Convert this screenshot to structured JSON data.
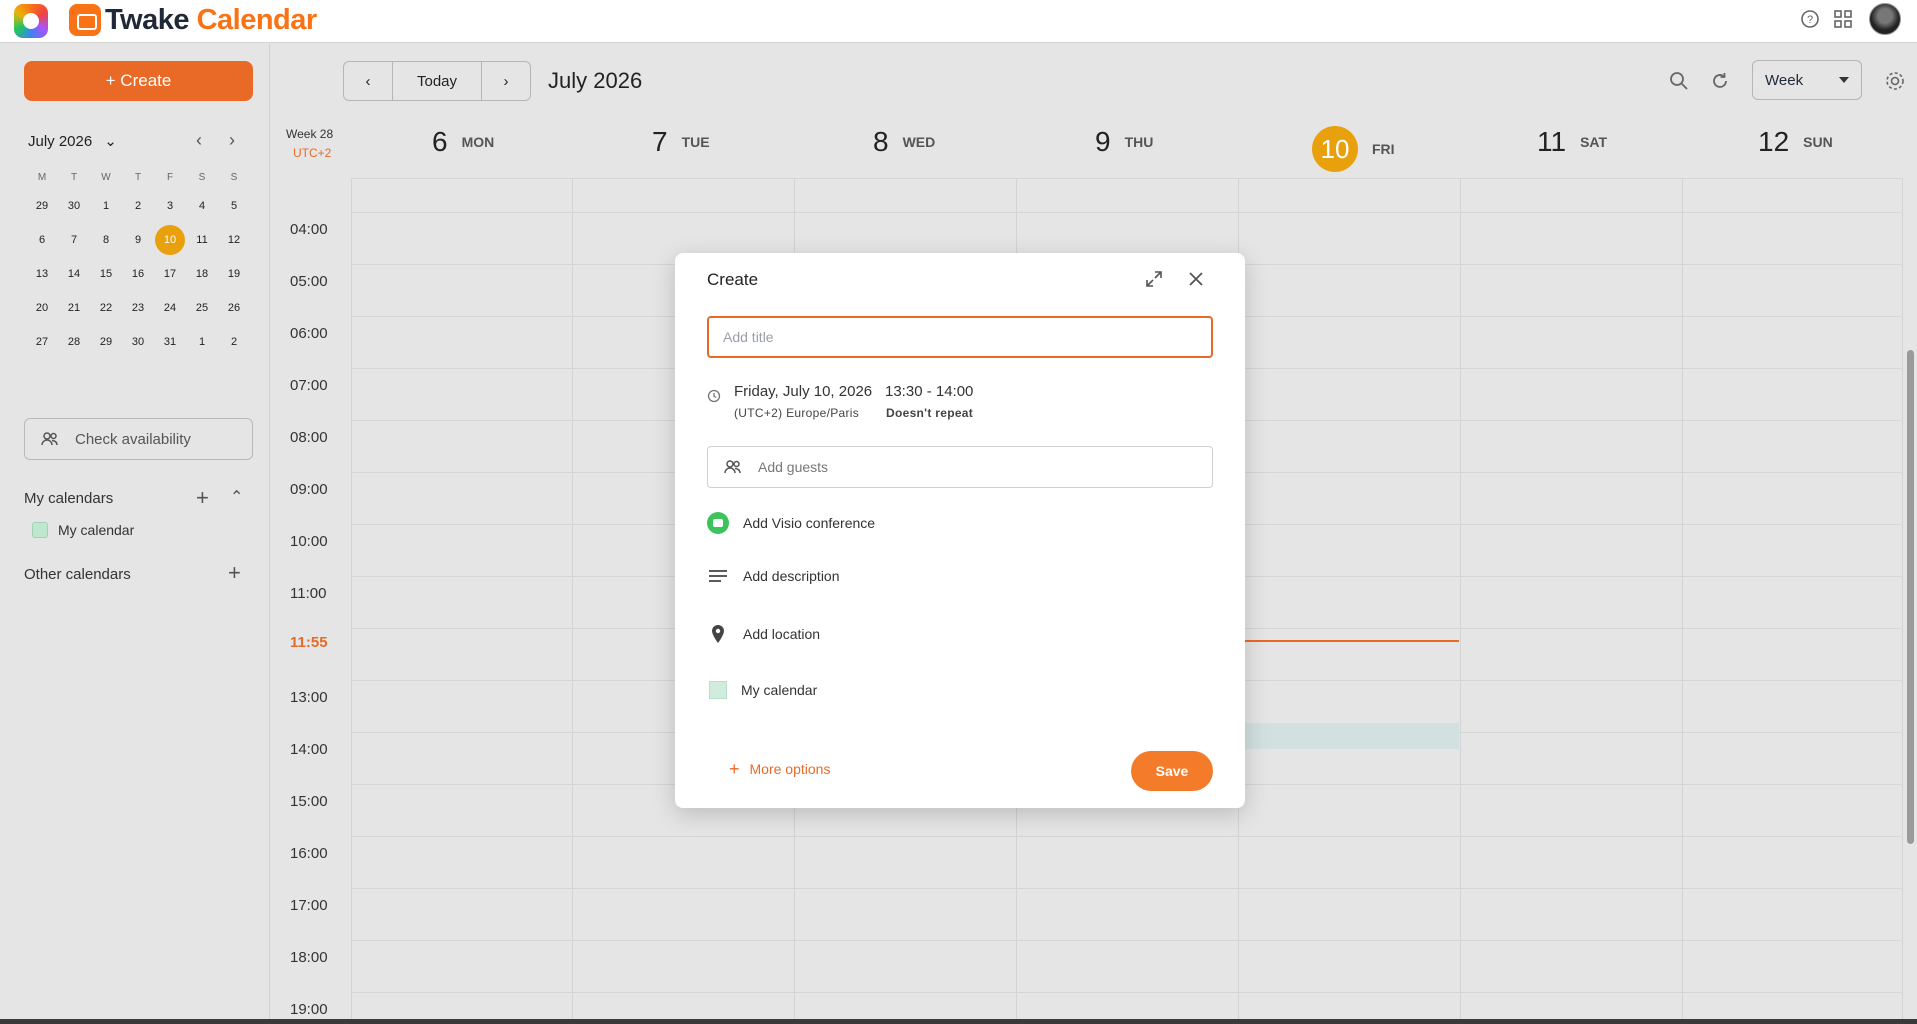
{
  "app": {
    "brand_part1": "Twake",
    "brand_part2": "Calendar",
    "icons": [
      "app-grid-icon",
      "help-icon",
      "apps-icon",
      "avatar"
    ]
  },
  "sidebar": {
    "create_label": "+ Create",
    "mini_calendar": {
      "month_label": "July 2026",
      "weekdays": [
        "M",
        "T",
        "W",
        "T",
        "F",
        "S",
        "S"
      ],
      "weeks": [
        [
          "29",
          "30",
          "1",
          "2",
          "3",
          "4",
          "5"
        ],
        [
          "6",
          "7",
          "8",
          "9",
          "10",
          "11",
          "12"
        ],
        [
          "13",
          "14",
          "15",
          "16",
          "17",
          "18",
          "19"
        ],
        [
          "20",
          "21",
          "22",
          "23",
          "24",
          "25",
          "26"
        ],
        [
          "27",
          "28",
          "29",
          "30",
          "31",
          "1",
          "2"
        ]
      ],
      "selected_day": "10"
    },
    "check_availability": "Check availability",
    "my_calendars_label": "My calendars",
    "my_calendar_item": "My calendar",
    "other_calendars_label": "Other calendars"
  },
  "toolbar": {
    "today_label": "Today",
    "period_label": "July 2026",
    "view_label": "Week"
  },
  "week_header": {
    "week_label": "Week 28",
    "timezone": "UTC+2",
    "days": [
      {
        "num": "6",
        "dow": "MON"
      },
      {
        "num": "7",
        "dow": "TUE"
      },
      {
        "num": "8",
        "dow": "WED"
      },
      {
        "num": "9",
        "dow": "THU"
      },
      {
        "num": "10",
        "dow": "FRI"
      },
      {
        "num": "11",
        "dow": "SAT"
      },
      {
        "num": "12",
        "dow": "SUN"
      }
    ]
  },
  "time_labels": [
    "04:00",
    "05:00",
    "06:00",
    "07:00",
    "08:00",
    "09:00",
    "10:00",
    "11:00",
    "11:55",
    "13:00",
    "14:00",
    "15:00",
    "16:00",
    "17:00",
    "18:00",
    "19:00"
  ],
  "modal": {
    "title": "Create",
    "title_placeholder": "Add title",
    "date": "Friday, July 10, 2026",
    "time_range": "13:30 - 14:00",
    "timezone": "(UTC+2) Europe/Paris",
    "repeat": "Doesn't repeat",
    "guests_placeholder": "Add guests",
    "visio": "Add Visio conference",
    "description": "Add description",
    "location": "Add location",
    "calendar": "My calendar",
    "more_options": "More options",
    "save": "Save"
  },
  "colors": {
    "accent": "#e96a26",
    "today_badge": "#e9a00d",
    "visio_green": "#3cc35c",
    "calendar_color": "#cfecdd"
  }
}
